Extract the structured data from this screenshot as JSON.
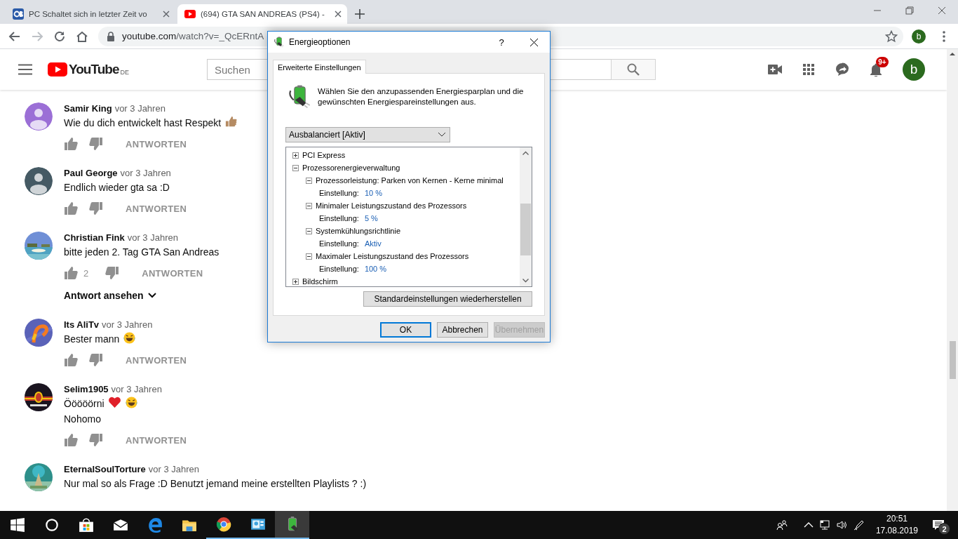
{
  "browser": {
    "tabs": [
      {
        "title": "PC Schaltet sich in letzter Zeit vo",
        "selected": false
      },
      {
        "title": "(694) GTA SAN ANDREAS (PS4) -",
        "selected": true
      }
    ],
    "forward_disabled": true,
    "address": {
      "host": "youtube.com",
      "path": "/watch?v=_QcERntA"
    },
    "profile": "b"
  },
  "youtube": {
    "logo": "YouTube",
    "region": "DE",
    "search_placeholder": "Suchen",
    "notifications": "9+",
    "avatar": "b"
  },
  "comments": [
    {
      "author": "Samir King",
      "time": "vor 3 Jahren",
      "avatar": {
        "kind": "default",
        "color": "#9b6fd6"
      },
      "lines": [
        {
          "text": "Wie du dich entwickelt hast Respekt",
          "emojis": [
            {
              "kind": "thumbs-up"
            }
          ]
        }
      ],
      "reply": "ANTWORTEN"
    },
    {
      "author": "Paul George",
      "time": "vor 3 Jahren",
      "avatar": {
        "kind": "default",
        "color": "#455a64"
      },
      "lines": [
        {
          "text": "Endlich wieder gta sa :D"
        }
      ],
      "reply": "ANTWORTEN"
    },
    {
      "author": "Christian Fink",
      "time": "vor 3 Jahren",
      "avatar": {
        "kind": "picture"
      },
      "lines": [
        {
          "text": "bitte jeden 2. Tag GTA San Andreas"
        }
      ],
      "likes": "2",
      "reply": "ANTWORTEN",
      "view_replies": "Antwort ansehen"
    },
    {
      "author": "Its AliTv",
      "time": "vor 3 Jahren",
      "avatar": {
        "kind": "picture"
      },
      "lines": [
        {
          "text": "Bester mann",
          "emojis": [
            {
              "kind": "laugh"
            }
          ]
        }
      ],
      "reply": "ANTWORTEN"
    },
    {
      "author": "Selim1905",
      "time": "vor 3 Jahren",
      "avatar": {
        "kind": "picture"
      },
      "lines": [
        {
          "text": "Ööööörni",
          "emojis": [
            {
              "kind": "heart"
            },
            {
              "kind": "laugh"
            }
          ]
        },
        {
          "text": "Nohomo"
        }
      ],
      "reply": "ANTWORTEN"
    },
    {
      "author": "EternalSoulTorture",
      "time": "vor 3 Jahren",
      "avatar": {
        "kind": "picture"
      },
      "lines": [
        {
          "text": "Nur mal so als Frage :D Benutzt jemand meine erstellten Playlists ? :)"
        }
      ]
    }
  ],
  "dialog": {
    "title": "Energieoptionen",
    "help": "?",
    "tabs": [
      {
        "label": "Erweiterte Einstellungen",
        "selected": true
      }
    ],
    "intro": "Wählen Sie den anzupassenden Energiesparplan und die\ngewünschten Energiespareinstellungen aus.",
    "plan": "Ausbalanciert [Aktiv]",
    "tree": [
      {
        "label": "PCI Express",
        "expanded": false
      },
      {
        "label": "Prozessorenergieverwaltung",
        "expanded": true,
        "children": [
          {
            "label": "Prozessorleistung: Parken von Kernen - Kerne minimal",
            "expanded": true,
            "children": [
              {
                "label": "Einstellung:",
                "value": "10 %"
              }
            ]
          },
          {
            "label": "Minimaler Leistungszustand des Prozessors",
            "expanded": true,
            "children": [
              {
                "label": "Einstellung:",
                "value": "5 %"
              }
            ]
          },
          {
            "label": "Systemkühlungsrichtlinie",
            "expanded": true,
            "children": [
              {
                "label": "Einstellung:",
                "value": "Aktiv"
              }
            ]
          },
          {
            "label": "Maximaler Leistungszustand des Prozessors",
            "expanded": true,
            "children": [
              {
                "label": "Einstellung:",
                "value": "100 %"
              }
            ]
          }
        ]
      },
      {
        "label": "Bildschirm",
        "expanded": false
      }
    ],
    "restore_button": "Standardeinstellungen wiederherstellen",
    "buttons": [
      {
        "label": "OK",
        "kind": "default",
        "disabled": false
      },
      {
        "label": "Abbrechen",
        "kind": "normal",
        "disabled": false
      },
      {
        "label": "Übernehmen",
        "kind": "normal",
        "disabled": true
      }
    ]
  },
  "taskbar": {
    "apps": [
      {
        "kind": "start",
        "running": false,
        "active": false
      },
      {
        "kind": "search",
        "running": false,
        "active": false
      },
      {
        "kind": "store",
        "running": false,
        "active": false
      },
      {
        "kind": "mail",
        "running": false,
        "active": false
      },
      {
        "kind": "edge",
        "running": false,
        "active": false
      },
      {
        "kind": "explorer",
        "running": false,
        "active": false
      },
      {
        "kind": "chrome",
        "running": true,
        "active": false
      },
      {
        "kind": "control",
        "running": true,
        "active": false
      },
      {
        "kind": "power",
        "running": true,
        "active": true
      }
    ],
    "time": "20:51",
    "date": "17.08.2019",
    "notifications": "2"
  }
}
